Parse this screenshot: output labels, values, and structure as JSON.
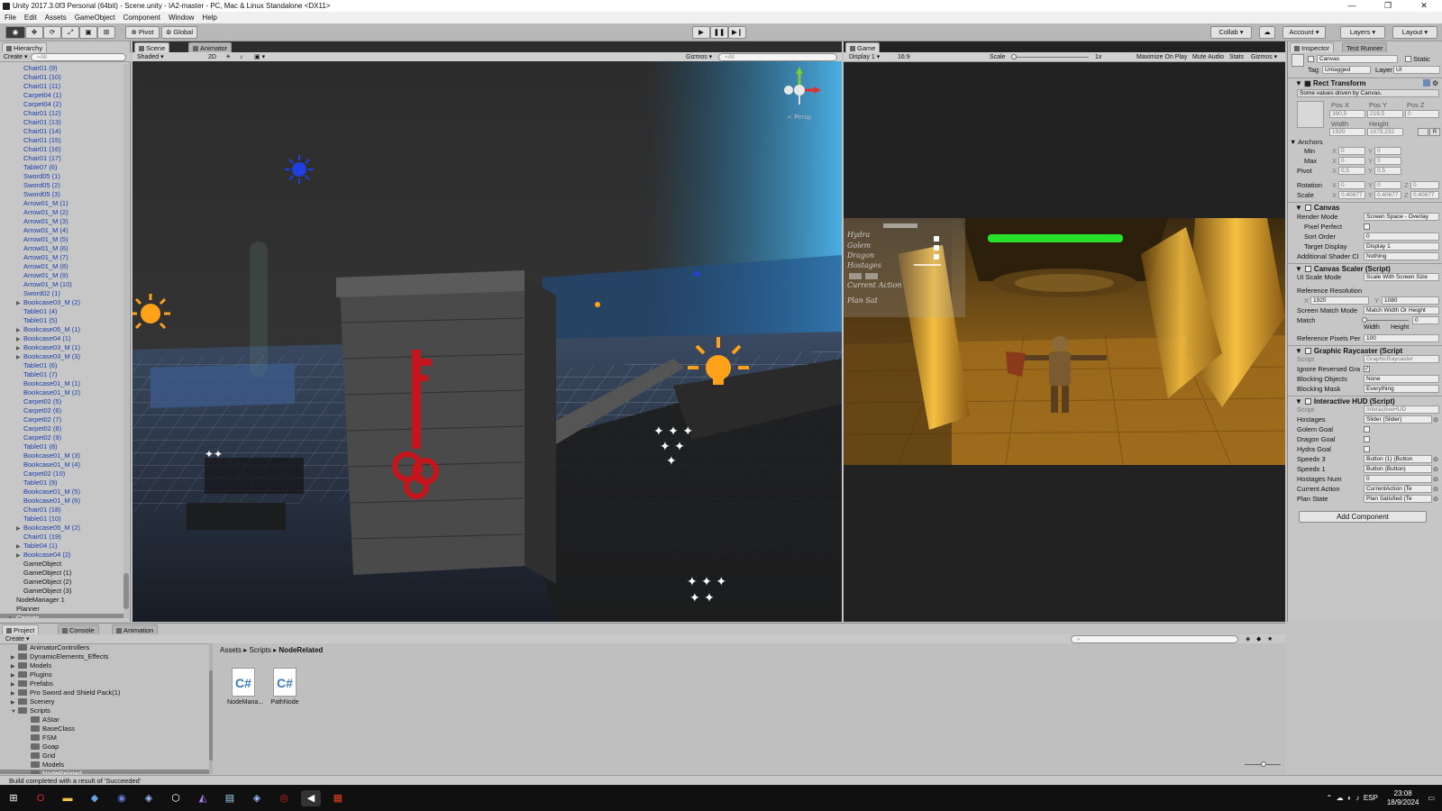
{
  "window": {
    "title": "Unity 2017.3.0f3 Personal (64bit) - Scene.unity - IA2-master - PC, Mac & Linux Standalone <DX11>",
    "controls": [
      "—",
      "❐",
      "✕"
    ]
  },
  "menu": [
    "File",
    "Edit",
    "Assets",
    "GameObject",
    "Component",
    "Window",
    "Help"
  ],
  "toolbar": {
    "pivot": "Pivot",
    "global": "Global",
    "collab": "Collab ▾",
    "account": "Account",
    "layers": "Layers",
    "layout": "Layout"
  },
  "hierarchy": {
    "tab": "Hierarchy",
    "create": "Create",
    "search_placeholder": "All",
    "items": [
      {
        "label": "Chair01 (9)",
        "exp": false
      },
      {
        "label": "Chair01 (10)",
        "exp": false
      },
      {
        "label": "Chair01 (11)",
        "exp": false
      },
      {
        "label": "Carpet04 (1)",
        "exp": false
      },
      {
        "label": "Carpet04 (2)",
        "exp": false
      },
      {
        "label": "Chair01 (12)",
        "exp": false
      },
      {
        "label": "Chair01 (13)",
        "exp": false
      },
      {
        "label": "Chair01 (14)",
        "exp": false
      },
      {
        "label": "Chair01 (15)",
        "exp": false
      },
      {
        "label": "Chair01 (16)",
        "exp": false
      },
      {
        "label": "Chair01 (17)",
        "exp": false
      },
      {
        "label": "Table07 (6)",
        "exp": false
      },
      {
        "label": "Sword05 (1)",
        "exp": false
      },
      {
        "label": "Sword05 (2)",
        "exp": false
      },
      {
        "label": "Sword05 (3)",
        "exp": false
      },
      {
        "label": "Arrow01_M (1)",
        "exp": false
      },
      {
        "label": "Arrow01_M (2)",
        "exp": false
      },
      {
        "label": "Arrow01_M (3)",
        "exp": false
      },
      {
        "label": "Arrow01_M (4)",
        "exp": false
      },
      {
        "label": "Arrow01_M (5)",
        "exp": false
      },
      {
        "label": "Arrow01_M (6)",
        "exp": false
      },
      {
        "label": "Arrow01_M (7)",
        "exp": false
      },
      {
        "label": "Arrow01_M (8)",
        "exp": false
      },
      {
        "label": "Arrow01_M (9)",
        "exp": false
      },
      {
        "label": "Arrow01_M (10)",
        "exp": false
      },
      {
        "label": "Sword02 (1)",
        "exp": false
      },
      {
        "label": "Bookcase03_M (2)",
        "exp": true
      },
      {
        "label": "Table01 (4)",
        "exp": false
      },
      {
        "label": "Table01 (5)",
        "exp": false
      },
      {
        "label": "Bookcase05_M (1)",
        "exp": true
      },
      {
        "label": "Bookcase04 (1)",
        "exp": true
      },
      {
        "label": "Bookcase03_M (1)",
        "exp": true
      },
      {
        "label": "Bookcase03_M (3)",
        "exp": true
      },
      {
        "label": "Table01 (6)",
        "exp": false
      },
      {
        "label": "Table01 (7)",
        "exp": false
      },
      {
        "label": "Bookcase01_M (1)",
        "exp": false
      },
      {
        "label": "Bookcase01_M (2)",
        "exp": false
      },
      {
        "label": "Carpet02 (5)",
        "exp": false
      },
      {
        "label": "Carpet02 (6)",
        "exp": false
      },
      {
        "label": "Carpet02 (7)",
        "exp": false
      },
      {
        "label": "Carpet02 (8)",
        "exp": false
      },
      {
        "label": "Carpet02 (9)",
        "exp": false
      },
      {
        "label": "Table01 (8)",
        "exp": false
      },
      {
        "label": "Bookcase01_M (3)",
        "exp": false
      },
      {
        "label": "Bookcase01_M (4)",
        "exp": false
      },
      {
        "label": "Carpet02 (10)",
        "exp": false
      },
      {
        "label": "Table01 (9)",
        "exp": false
      },
      {
        "label": "Bookcase01_M (5)",
        "exp": false
      },
      {
        "label": "Bookcase01_M (6)",
        "exp": false
      },
      {
        "label": "Chair01 (18)",
        "exp": false
      },
      {
        "label": "Table01 (10)",
        "exp": false
      },
      {
        "label": "Bookcase05_M (2)",
        "exp": true
      },
      {
        "label": "Chair01 (19)",
        "exp": false
      },
      {
        "label": "Table04 (1)",
        "exp": true
      },
      {
        "label": "Bookcase04 (2)",
        "exp": true
      }
    ],
    "plain_items": [
      "GameObject",
      "GameObject (1)",
      "GameObject (2)",
      "GameObject (3)"
    ],
    "root_items": [
      "NodeManager 1",
      "Planner"
    ],
    "selected": "Canvas"
  },
  "scene": {
    "tab": "Scene",
    "tab2": "Animator",
    "shading": "Shaded",
    "mode2d": "2D",
    "gizmos": "Gizmos ▾",
    "search_placeholder": "All",
    "persp": "< Persp"
  },
  "game": {
    "tab": "Game",
    "display": "Display 1",
    "aspect": "16:9",
    "scale_label": "Scale",
    "scale_value": "1x",
    "maximize": "Maximize On Play",
    "mute": "Mute Audio",
    "stats": "Stats",
    "gizmos": "Gizmos ▾",
    "hud": [
      "Hydra",
      "Golem",
      "Dragon",
      "Hostages",
      "Current Action",
      "Plan Sat"
    ]
  },
  "inspector": {
    "tab": "Inspector",
    "tab2": "Test Runner",
    "object_name": "Canvas",
    "static": "Static",
    "tag_label": "Tag",
    "tag": "Untagged",
    "layer_label": "Layer",
    "layer": "UI",
    "rect_transform": {
      "title": "Rect Transform",
      "note": "Some values driven by Canvas.",
      "posx_label": "Pos X",
      "posy_label": "Pos Y",
      "posz_label": "Pos Z",
      "posx": "390,5",
      "posy": "219,5",
      "posz": "0",
      "width_label": "Width",
      "height_label": "Height",
      "width": "1920",
      "height": "1079,232",
      "r_button": "R",
      "anchors": "Anchors",
      "min_label": "Min",
      "max_label": "Max",
      "pivot_label": "Pivot",
      "min_x": "0",
      "min_y": "0",
      "max_x": "0",
      "max_y": "0",
      "pivot_x": "0,5",
      "pivot_y": "0,5",
      "rotation_label": "Rotation",
      "rot_x": "0",
      "rot_y": "0",
      "rot_z": "0",
      "scale_label": "Scale",
      "scale_x": "0,40677",
      "scale_y": "0,40677",
      "scale_z": "0,40677",
      "x": "X",
      "y": "Y",
      "z": "Z"
    },
    "canvas": {
      "title": "Canvas",
      "render_mode_label": "Render Mode",
      "render_mode": "Screen Space - Overlay",
      "pixel_perfect_label": "Pixel Perfect",
      "sort_order_label": "Sort Order",
      "sort_order": "0",
      "target_display_label": "Target Display",
      "target_display": "Display 1",
      "shader_label": "Additional Shader Cl",
      "shader": "Nothing"
    },
    "canvas_scaler": {
      "title": "Canvas Scaler (Script)",
      "scale_mode_label": "UI Scale Mode",
      "scale_mode": "Scale With Screen Size",
      "ref_res_label": "Reference Resolution",
      "ref_x": "1920",
      "ref_y": "1080",
      "match_mode_label": "Screen Match Mode",
      "match_mode": "Match Width Or Height",
      "match_label": "Match",
      "match": "0",
      "width_label": "Width",
      "height_label": "Height",
      "ref_ppu_label": "Reference Pixels Per",
      "ref_ppu": "100"
    },
    "raycaster": {
      "title": "Graphic Raycaster (Script",
      "script_label": "Script",
      "script": "GraphicRaycaster",
      "ignore_label": "Ignore Reversed Gra",
      "blocking_label": "Blocking Objects",
      "blocking": "None",
      "mask_label": "Blocking Mask",
      "mask": "Everything"
    },
    "hud": {
      "title": "Interactive HUD (Script)",
      "script_label": "Script",
      "script": "InteractiveHUD",
      "rows": [
        {
          "label": "Hostages",
          "value": "Slider (Slider)"
        },
        {
          "label": "Golem Goal",
          "value": ""
        },
        {
          "label": "Dragon Goal",
          "value": ""
        },
        {
          "label": "Hydra Goal",
          "value": ""
        },
        {
          "label": "Speedx 3",
          "value": "Button (1) (Button"
        },
        {
          "label": "Speedx 1",
          "value": "Button (Button)"
        },
        {
          "label": "Hostages Num",
          "value": "0"
        },
        {
          "label": "Current Action",
          "value": "CurrentAction (Te"
        },
        {
          "label": "Plan State",
          "value": "Plan Satisfied (Te"
        }
      ]
    },
    "add_component": "Add Component"
  },
  "project": {
    "tab": "Project",
    "tab2": "Console",
    "tab3": "Animation",
    "create": "Create",
    "breadcrumb": [
      "Assets",
      "Scripts",
      "NodeRelated"
    ],
    "tree": [
      {
        "label": "AnimatorControllers",
        "depth": 1,
        "arrow": ""
      },
      {
        "label": "DynamicElements_Effects",
        "depth": 1,
        "arrow": "▶"
      },
      {
        "label": "Models",
        "depth": 1,
        "arrow": "▶"
      },
      {
        "label": "Plugins",
        "depth": 1,
        "arrow": "▶"
      },
      {
        "label": "Prefabs",
        "depth": 1,
        "arrow": "▶"
      },
      {
        "label": "Pro Sword and Shield Pack(1)",
        "depth": 1,
        "arrow": "▶"
      },
      {
        "label": "Scenery",
        "depth": 1,
        "arrow": "▶"
      },
      {
        "label": "Scripts",
        "depth": 1,
        "arrow": "▼"
      },
      {
        "label": "AStar",
        "depth": 2,
        "arrow": ""
      },
      {
        "label": "BaseClass",
        "depth": 2,
        "arrow": ""
      },
      {
        "label": "FSM",
        "depth": 2,
        "arrow": ""
      },
      {
        "label": "Goap",
        "depth": 2,
        "arrow": ""
      },
      {
        "label": "Grid",
        "depth": 2,
        "arrow": ""
      },
      {
        "label": "Models",
        "depth": 2,
        "arrow": ""
      },
      {
        "label": "NodeRelated",
        "depth": 2,
        "arrow": "",
        "sel": true
      }
    ],
    "files": [
      "NodeMana...",
      "PathNode"
    ],
    "file_glyph": "C#"
  },
  "status": "Build completed with a result of 'Succeeded'",
  "taskbar": {
    "lang": "ESP",
    "time": "23:08",
    "date": "18/9/2024"
  }
}
